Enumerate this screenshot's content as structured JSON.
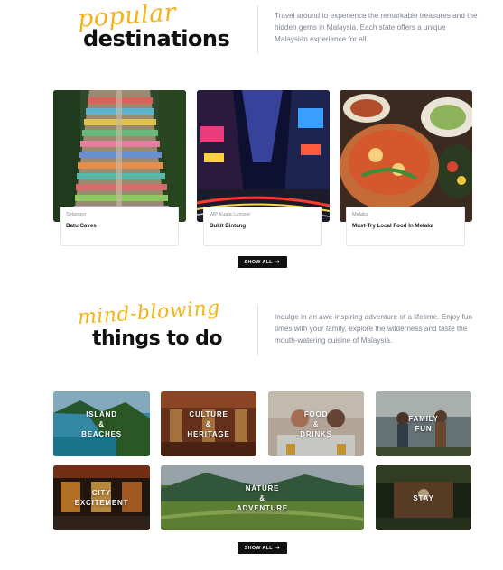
{
  "destinations_section": {
    "script_title": "popular",
    "title": "destinations",
    "description": "Travel around to experience the remarkable treasures and the hidden gems in Malaysia. Each state offers a unique Malaysian experience for all.",
    "cards": [
      {
        "state": "Selangor",
        "name": "Batu Caves"
      },
      {
        "state": "WP Kuala Lumpur",
        "name": "Bukit Bintang"
      },
      {
        "state": "Melaka",
        "name": "Must-Try Local Food In Melaka"
      }
    ],
    "show_all": "SHOW ALL"
  },
  "things_section": {
    "script_title": "mind-blowing",
    "title": "things to do",
    "description": "Indulge in an awe-inspiring adventure of a lifetime. Enjoy fun times with your family, explore the wilderness and taste the mouth-watering cuisine of Malaysia.",
    "tiles": [
      {
        "label": "ISLAND\n&\nBEACHES"
      },
      {
        "label": "CULTURE\n&\nHERITAGE"
      },
      {
        "label": "FOOD\n&\nDRINKS"
      },
      {
        "label": "FAMILY\nFUN"
      },
      {
        "label": "CITY\nEXCITEMENT"
      },
      {
        "label": "NATURE\n&\nADVENTURE"
      },
      {
        "label": "STAY"
      }
    ],
    "show_all": "SHOW ALL"
  },
  "icons": {
    "arrow": "arrow-right-icon"
  },
  "colors": {
    "accent": "#f5b31a",
    "button": "#111111"
  }
}
